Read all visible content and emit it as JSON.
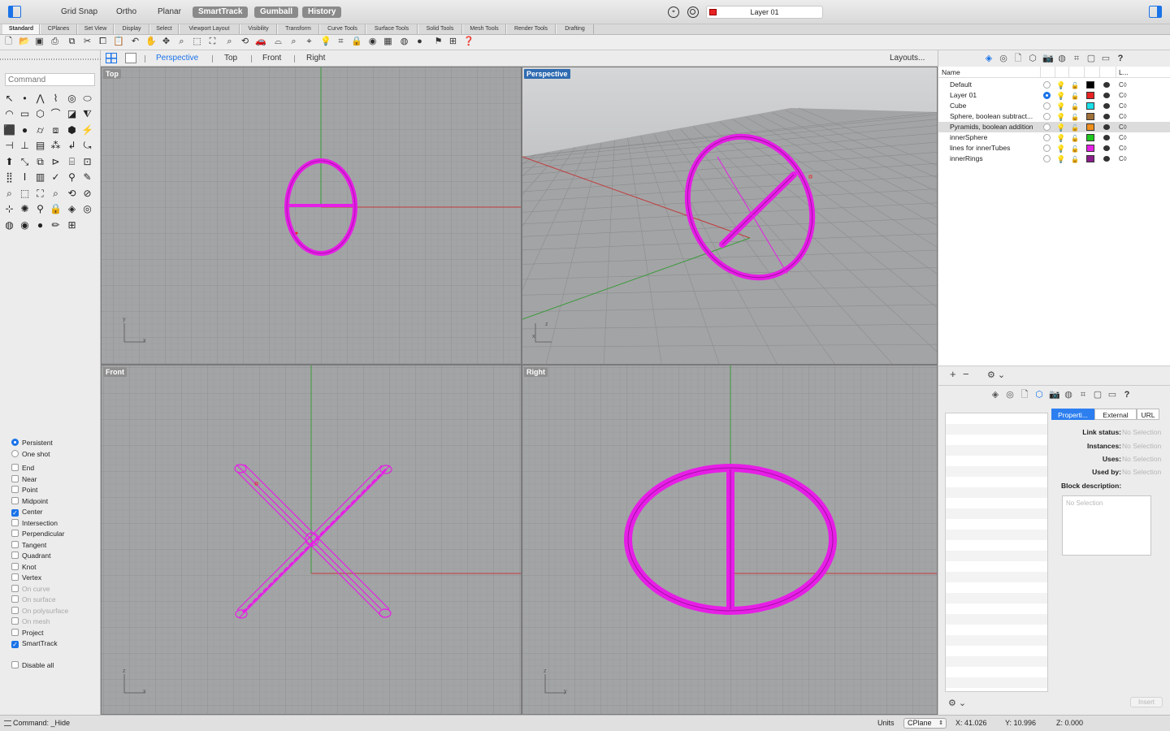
{
  "toolbar": {
    "modes": [
      {
        "label": "Grid Snap",
        "on": false
      },
      {
        "label": "Ortho",
        "on": false
      },
      {
        "label": "Planar",
        "on": false
      },
      {
        "label": "SmartTrack",
        "on": true
      },
      {
        "label": "Gumball",
        "on": true
      },
      {
        "label": "History",
        "on": true
      }
    ],
    "current_layer": "Layer 01",
    "current_layer_color": "#e82222"
  },
  "tabs": [
    "Standard",
    "CPlanes",
    "Set View",
    "Display",
    "Select",
    "Viewport Layout",
    "Visibility",
    "Transform",
    "Curve Tools",
    "Surface Tools",
    "Solid Tools",
    "Mesh Tools",
    "Render Tools",
    "Drafting"
  ],
  "command": {
    "placeholder": "Command"
  },
  "viewport_tabs": [
    "Perspective",
    "Top",
    "Front",
    "Right"
  ],
  "active_viewport_tab": "Perspective",
  "layouts_label": "Layouts...",
  "viewports": {
    "top": "Top",
    "perspective": "Perspective",
    "front": "Front",
    "right": "Right"
  },
  "accent": "#1a73e8",
  "object_color": "#e61ee6",
  "osnaps": [
    {
      "label": "Persistent",
      "type": "radio",
      "on": true
    },
    {
      "label": "One shot",
      "type": "radio",
      "on": false
    },
    {
      "label": "End",
      "type": "check",
      "on": false
    },
    {
      "label": "Near",
      "type": "check",
      "on": false
    },
    {
      "label": "Point",
      "type": "check",
      "on": false
    },
    {
      "label": "Midpoint",
      "type": "check",
      "on": false
    },
    {
      "label": "Center",
      "type": "check",
      "on": true
    },
    {
      "label": "Intersection",
      "type": "check",
      "on": false
    },
    {
      "label": "Perpendicular",
      "type": "check",
      "on": false
    },
    {
      "label": "Tangent",
      "type": "check",
      "on": false
    },
    {
      "label": "Quadrant",
      "type": "check",
      "on": false
    },
    {
      "label": "Knot",
      "type": "check",
      "on": false
    },
    {
      "label": "Vertex",
      "type": "check",
      "on": false
    },
    {
      "label": "On curve",
      "type": "check",
      "on": false,
      "disabled": true
    },
    {
      "label": "On surface",
      "type": "check",
      "on": false,
      "disabled": true
    },
    {
      "label": "On polysurface",
      "type": "check",
      "on": false,
      "disabled": true
    },
    {
      "label": "On mesh",
      "type": "check",
      "on": false,
      "disabled": true
    },
    {
      "label": "Project",
      "type": "check",
      "on": false
    },
    {
      "label": "SmartTrack",
      "type": "check",
      "on": true
    },
    {
      "label": "Disable all",
      "type": "check",
      "on": false
    }
  ],
  "layers": {
    "header_name": "Name",
    "header_ltype": "L...",
    "rows": [
      {
        "name": "Default",
        "current": false,
        "on": false,
        "color": "#000000"
      },
      {
        "name": "Layer 01",
        "current": true,
        "on": true,
        "color": "#e82222"
      },
      {
        "name": "Cube",
        "current": false,
        "on": false,
        "color": "#1ae0e8"
      },
      {
        "name": "Sphere, boolean subtract...",
        "current": false,
        "on": true,
        "color": "#a0703a"
      },
      {
        "name": "Pyramids, boolean addition",
        "current": false,
        "on": false,
        "color": "#f0901e",
        "selected": true
      },
      {
        "name": "innerSphere",
        "current": false,
        "on": false,
        "color": "#1ec81e"
      },
      {
        "name": "lines for innerTubes",
        "current": false,
        "on": true,
        "color": "#e61ee6"
      },
      {
        "name": "innerRings",
        "current": false,
        "on": false,
        "color": "#8a1e8a"
      }
    ],
    "linetype_glyph": "C◊"
  },
  "blocks": {
    "tabs": [
      "Properti...",
      "External",
      "URL"
    ],
    "props": [
      {
        "label": "Link status:",
        "value": "No Selection"
      },
      {
        "label": "Instances:",
        "value": "No Selection"
      },
      {
        "label": "Uses:",
        "value": "No Selection"
      },
      {
        "label": "Used by:",
        "value": "No Selection"
      }
    ],
    "desc_label": "Block description:",
    "desc_placeholder": "No Selection",
    "insert": "Insert"
  },
  "status": {
    "command": "Command: _Hide",
    "units": "Units",
    "cplane": "CPlane",
    "x": "X: 41.026",
    "y": "Y: 10.996",
    "z": "Z: 0.000"
  }
}
